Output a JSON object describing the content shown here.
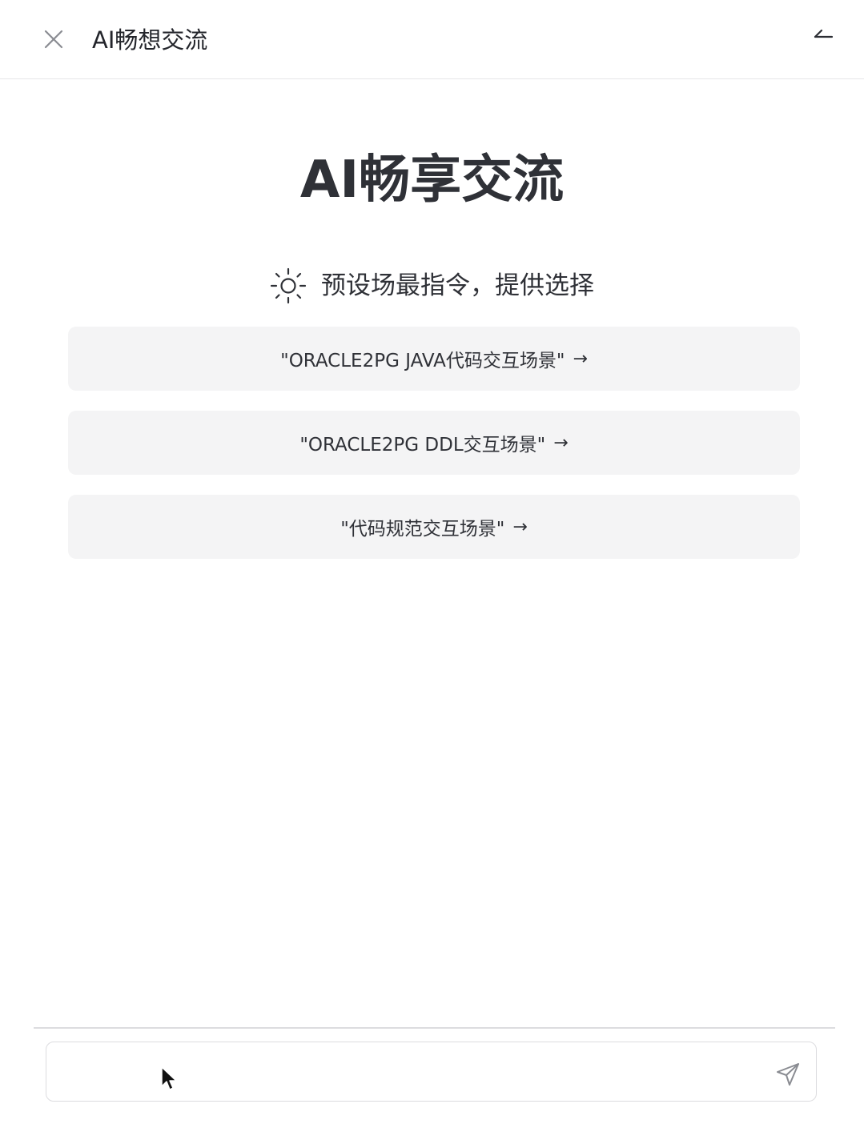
{
  "header": {
    "title": "AI畅想交流",
    "close_icon": "close-icon",
    "minimize_icon": "minimize-icon"
  },
  "hero": {
    "title": "AI畅享交流"
  },
  "subtitle": {
    "icon": "sun-icon",
    "text": "预设场最指令，提供选择"
  },
  "prompts": [
    {
      "label": "\"ORACLE2PG JAVA代码交互场景\"",
      "arrow": "→"
    },
    {
      "label": "\"ORACLE2PG DDL交互场景\"",
      "arrow": "→"
    },
    {
      "label": "\"代码规范交互场景\"",
      "arrow": "→"
    }
  ],
  "input": {
    "value": "",
    "placeholder": "",
    "send_icon": "send-icon"
  },
  "colors": {
    "card_bg": "#f4f4f5",
    "text": "#2f3137",
    "border": "#dcdcdf"
  }
}
